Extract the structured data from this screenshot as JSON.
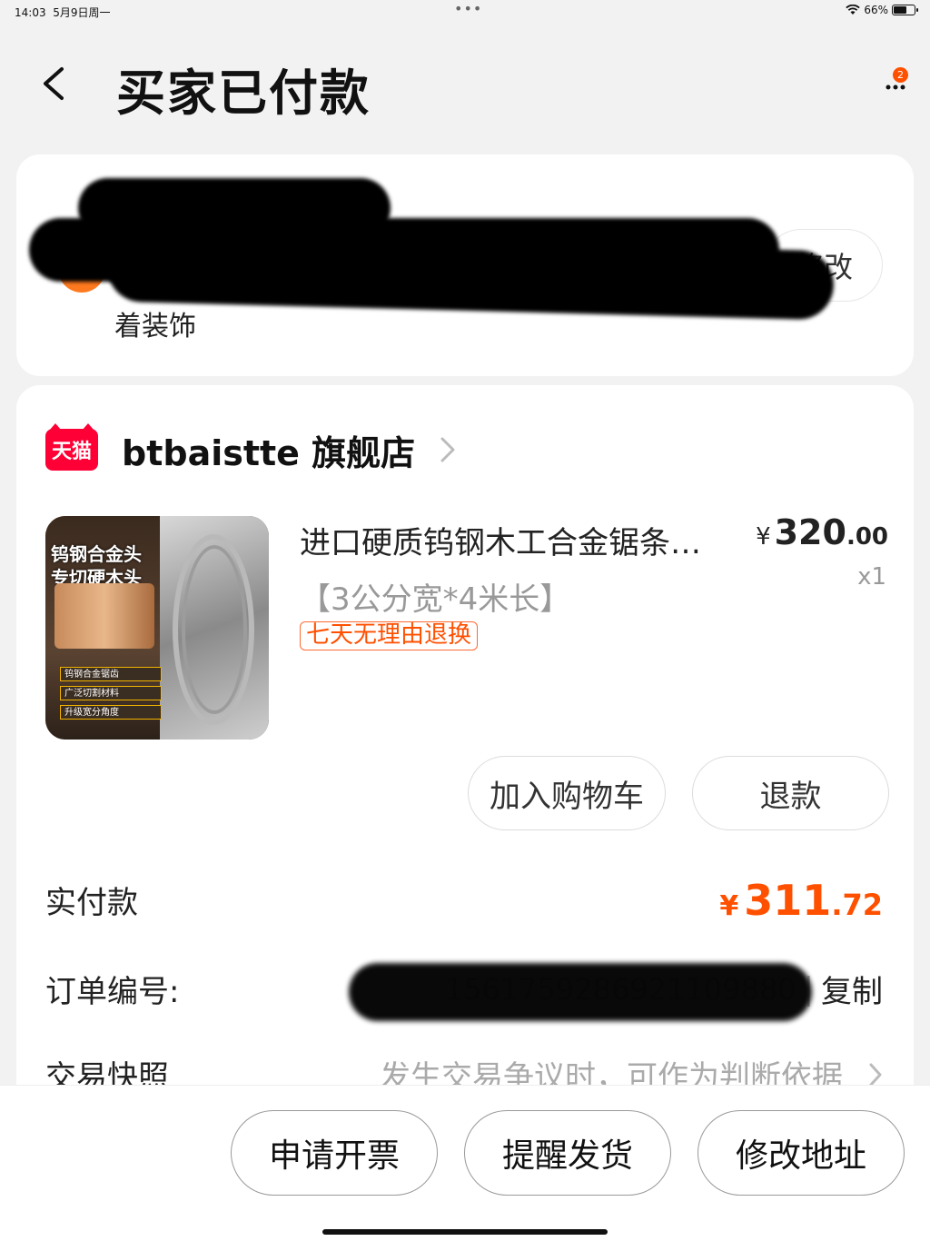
{
  "status_bar": {
    "time": "14:03",
    "date": "5月9日周一",
    "battery": "66%",
    "battery_level": 0.66
  },
  "nav": {
    "title": "买家已付款",
    "more_badge": "2"
  },
  "address": {
    "modify_label": "修改",
    "visible_fragment": "着装饰"
  },
  "shop": {
    "platform_logo": "天猫",
    "name": "btbaistte 旗舰店"
  },
  "product": {
    "image_title_line1": "钨钢合金头",
    "image_title_line2": "专切硬木头",
    "image_features": [
      "钨钢合金锯齿",
      "广泛切割材料",
      "升级宽分角度"
    ],
    "title": "进口硬质钨钢木工合金锯条…",
    "price_currency": "¥",
    "price_int": "320",
    "price_dec": ".00",
    "qty": "x1",
    "sku": "【3公分宽*4米长】",
    "return_tag": "七天无理由退换"
  },
  "actions": {
    "add_cart": "加入购物车",
    "refund": "退款"
  },
  "order_info": {
    "paid_label": "实付款",
    "paid_currency": "¥",
    "paid_int": "311",
    "paid_dec": ".72",
    "order_no_label": "订单编号:",
    "order_no": "1561759286921109880",
    "order_no_sep": "|",
    "copy_label": "复制",
    "snapshot_label": "交易快照",
    "snapshot_hint": "发生交易争议时，可作为判断依据"
  },
  "bottom_bar": {
    "invoice": "申请开票",
    "remind": "提醒发货",
    "change_address": "修改地址"
  },
  "colors": {
    "accent": "#ff5000",
    "tmall_red": "#ff0036"
  }
}
